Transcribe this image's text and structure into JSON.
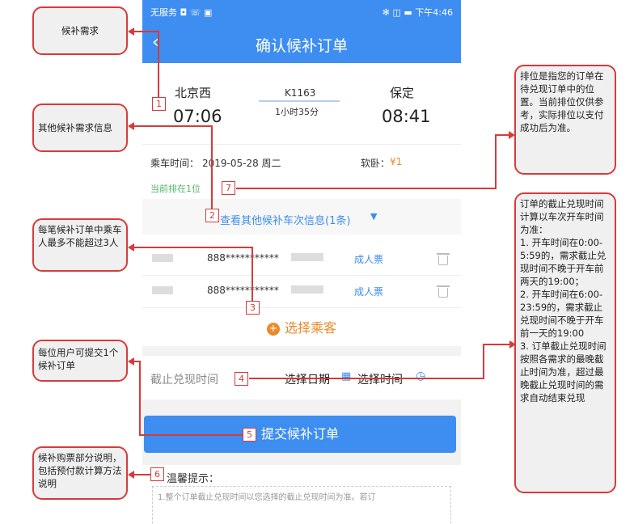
{
  "status": {
    "left": "无服务 ◘ ☏ ▣",
    "right": "✻ ◫ ▬ 下午4:46"
  },
  "title": "确认候补订单",
  "train": {
    "from_station": "北京西",
    "from_time": "07:06",
    "train_no": "K1163",
    "duration": "1小时35分",
    "to_station": "保定",
    "to_time": "08:41"
  },
  "ride": {
    "date_label": "乘车时间：",
    "date": "2019-05-28 周二",
    "seat_label": "软卧：",
    "seat_price": "¥1",
    "queue": "当前排在1位"
  },
  "other_link": "查看其他候补车次信息(1条)",
  "passengers": [
    {
      "name": "",
      "id": "888***********",
      "type": "成人票"
    },
    {
      "name": "",
      "id": "888***********",
      "type": "成人票"
    }
  ],
  "add_passenger": "选择乘客",
  "deadline": {
    "label": "截止兑现时间",
    "date": "选择日期",
    "time": "选择时间"
  },
  "submit": "提交候补订单",
  "tips": {
    "title": "温馨提示：",
    "text": "1.整个订单截止兑现时间以您选择的截止兑现时间为准。若订"
  },
  "callouts": {
    "c_need": "候补需求",
    "c_other": "其他候补需求信息",
    "c_pax": "每笔候补订单中乘车人最多不能超过3人",
    "c_user": "每位用户可提交1个候补订单",
    "c_tips": "候补购票部分说明，包括预付款计算方法说明",
    "c_rank": "排位是指您的订单在待兑现订单中的位置。当前排位仅供参考，实际排位以支付成功后为准。",
    "c_deadline": "订单的截止兑现时间计算以车次开车时间为准：\n1. 开车时间在0:00-5:59的，需求截止兑现时间不晚于开车前两天的19:00；\n2. 开车时间在6:00-23:59的，需求截止兑现时间不晚于开车前一天的19:00\n3. 订单截止兑现时间按照各需求的最晚截止时间为准，超过最晚截止兑现时间的需求自动结束兑现"
  },
  "markers": [
    "1",
    "2",
    "3",
    "4",
    "5",
    "6",
    "7"
  ],
  "colors": {
    "accent": "#3d8ef0",
    "annotation": "#d83a3a",
    "orange": "#e98b2a",
    "green": "#52b36a"
  }
}
